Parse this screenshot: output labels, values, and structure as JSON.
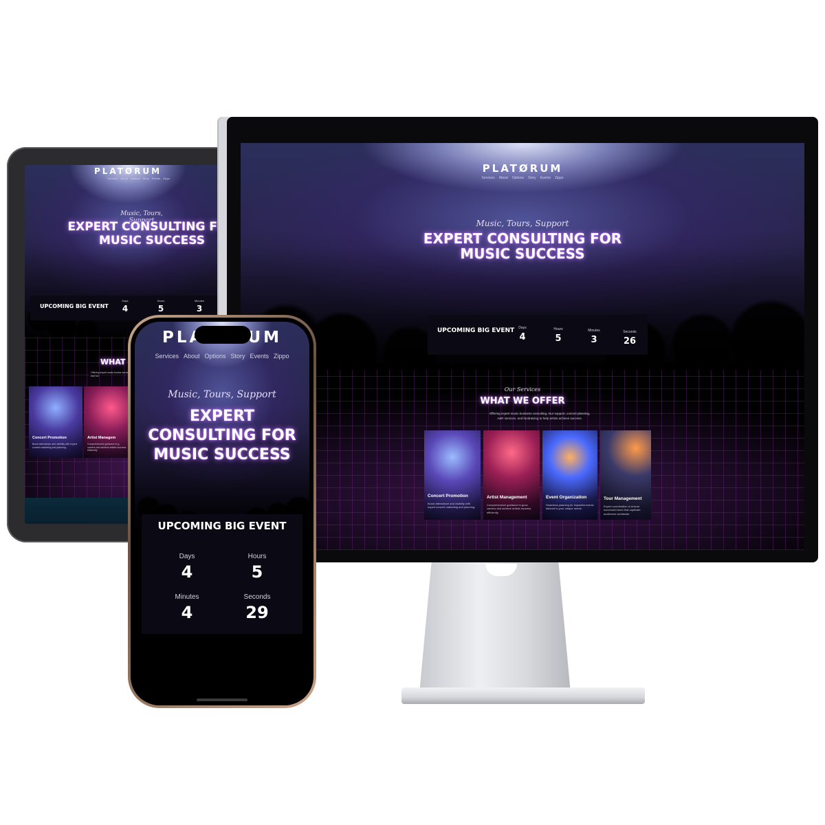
{
  "site": {
    "logo": "PLATØRUM",
    "nav": [
      "Services",
      "About",
      "Options",
      "Story",
      "Events",
      "Zippo"
    ],
    "tagline": "Music, Tours, Support",
    "headline_line1": "EXPERT CONSULTING FOR",
    "headline_line2": "MUSIC SUCCESS",
    "phone_headline": "EXPERT CONSULTING FOR MUSIC SUCCESS",
    "event": {
      "title": "UPCOMING BIG EVENT",
      "units": [
        "Days",
        "Hours",
        "Minutes",
        "Seconds"
      ]
    },
    "services": {
      "kicker": "Our Services",
      "title": "WHAT WE OFFER",
      "desc": "Offering expert music business consulting, tour support, concert planning, A&R services, and fundraising to help artists achieve success.",
      "cards": [
        {
          "title": "Concert Promotion",
          "desc": "Boost attendance and visibility with expert concert marketing and planning."
        },
        {
          "title": "Artist Management",
          "desc": "Comprehensive guidance to grow careers and achieve artistic success efficiently."
        },
        {
          "title": "Event Organization",
          "desc": "Seamless planning for impactful events tailored to your unique needs."
        },
        {
          "title": "Tour Management",
          "desc": "Expert coordination to ensure successful tours that captivate audiences worldwide."
        }
      ]
    }
  },
  "countdowns": {
    "desktop": [
      "4",
      "5",
      "3",
      "26"
    ],
    "tablet": [
      "4",
      "5",
      "3"
    ],
    "phone": [
      "4",
      "5",
      "4",
      "29"
    ]
  },
  "tablet_partial": {
    "services_title": "WHAT",
    "desc": "Offering expert music busine services, and fun",
    "card_artist": "Artist Managem",
    "card_artist_desc": "Comprehensive guidance to g careers and achieve artistic success efficiently"
  },
  "colors": {
    "accent_glow": "#c66dff",
    "background": "#000000",
    "event_box": "#0b0a14"
  }
}
